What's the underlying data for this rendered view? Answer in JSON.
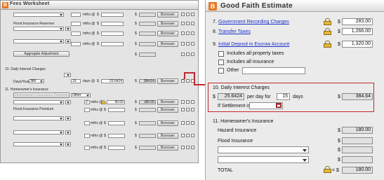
{
  "fees_worksheet": {
    "title": "Fees Worksheet",
    "mths_label": "mths @",
    "days_label": "days @",
    "currency": "$",
    "borrower_label": "Borrower",
    "flood_insurance_reserves": "Flood Insurance Reserves",
    "aggregate_adjustment": "Aggregate Adjustment",
    "section10": "10. Daily Interest Charges",
    "days_year_label": "Days/Year",
    "days_year_value": "360",
    "interest_days": "15",
    "interest_rate": "25.6424",
    "interest_total": "384.64",
    "section11": "11. Homeowner's Insurance",
    "insurance_type": "Other",
    "insurance_months": "2",
    "insurance_rate": "90.00",
    "insurance_total": "180.00",
    "flood_insurance_premium": "Flood Insurance Premium",
    "insurance_button": "Homeowner's Insurance Premium"
  },
  "gfe": {
    "title": "Good Faith Estimate",
    "currency": "$",
    "item7": "7.",
    "item7_link": "Government Recording Charges",
    "item7_value": "283.00",
    "item8": "8.",
    "item8_link": "Transfer Taxes",
    "item8_value": "1,266.00",
    "item9": "9.",
    "item9_link": "Initial Deposit in Escrow Account",
    "item9_value": "1,320.00",
    "cb1": "Includes all property taxes",
    "cb2": "Includes all insurance",
    "cb3": "Other",
    "section10_title": "10. Daily Interest Charges",
    "per_day_rate": "25.6424",
    "per_day_label": "per day for",
    "days": "15",
    "days_label": "days",
    "daily_total": "384.64",
    "settlement_label": "If Settlement is",
    "section11_title": "11. Homeowner's Insurance",
    "hazard_label": "Hazard Insurance",
    "hazard_value": "180.00",
    "flood_label": "Flood Insurance",
    "total_label": "TOTAL",
    "total_sign": "= $",
    "total_value": "180.00"
  },
  "colors": {
    "highlight": "#c0282e",
    "link": "#1a2fc9",
    "logo": "#e87722"
  }
}
